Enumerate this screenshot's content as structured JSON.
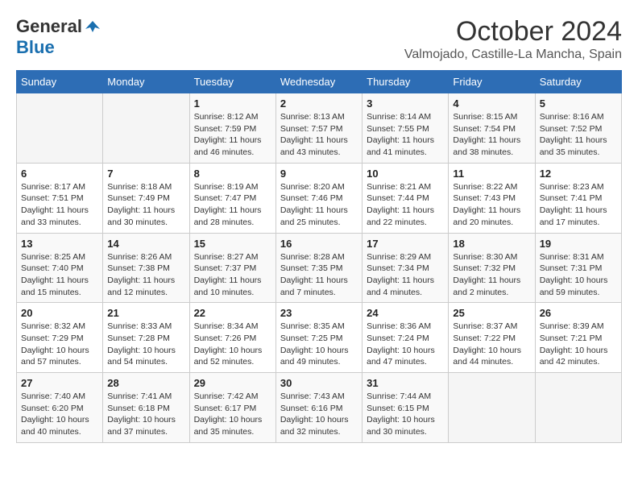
{
  "header": {
    "logo_general": "General",
    "logo_blue": "Blue",
    "month": "October 2024",
    "location": "Valmojado, Castille-La Mancha, Spain"
  },
  "weekdays": [
    "Sunday",
    "Monday",
    "Tuesday",
    "Wednesday",
    "Thursday",
    "Friday",
    "Saturday"
  ],
  "weeks": [
    [
      {
        "day": "",
        "sunrise": "",
        "sunset": "",
        "daylight": ""
      },
      {
        "day": "",
        "sunrise": "",
        "sunset": "",
        "daylight": ""
      },
      {
        "day": "1",
        "sunrise": "Sunrise: 8:12 AM",
        "sunset": "Sunset: 7:59 PM",
        "daylight": "Daylight: 11 hours and 46 minutes."
      },
      {
        "day": "2",
        "sunrise": "Sunrise: 8:13 AM",
        "sunset": "Sunset: 7:57 PM",
        "daylight": "Daylight: 11 hours and 43 minutes."
      },
      {
        "day": "3",
        "sunrise": "Sunrise: 8:14 AM",
        "sunset": "Sunset: 7:55 PM",
        "daylight": "Daylight: 11 hours and 41 minutes."
      },
      {
        "day": "4",
        "sunrise": "Sunrise: 8:15 AM",
        "sunset": "Sunset: 7:54 PM",
        "daylight": "Daylight: 11 hours and 38 minutes."
      },
      {
        "day": "5",
        "sunrise": "Sunrise: 8:16 AM",
        "sunset": "Sunset: 7:52 PM",
        "daylight": "Daylight: 11 hours and 35 minutes."
      }
    ],
    [
      {
        "day": "6",
        "sunrise": "Sunrise: 8:17 AM",
        "sunset": "Sunset: 7:51 PM",
        "daylight": "Daylight: 11 hours and 33 minutes."
      },
      {
        "day": "7",
        "sunrise": "Sunrise: 8:18 AM",
        "sunset": "Sunset: 7:49 PM",
        "daylight": "Daylight: 11 hours and 30 minutes."
      },
      {
        "day": "8",
        "sunrise": "Sunrise: 8:19 AM",
        "sunset": "Sunset: 7:47 PM",
        "daylight": "Daylight: 11 hours and 28 minutes."
      },
      {
        "day": "9",
        "sunrise": "Sunrise: 8:20 AM",
        "sunset": "Sunset: 7:46 PM",
        "daylight": "Daylight: 11 hours and 25 minutes."
      },
      {
        "day": "10",
        "sunrise": "Sunrise: 8:21 AM",
        "sunset": "Sunset: 7:44 PM",
        "daylight": "Daylight: 11 hours and 22 minutes."
      },
      {
        "day": "11",
        "sunrise": "Sunrise: 8:22 AM",
        "sunset": "Sunset: 7:43 PM",
        "daylight": "Daylight: 11 hours and 20 minutes."
      },
      {
        "day": "12",
        "sunrise": "Sunrise: 8:23 AM",
        "sunset": "Sunset: 7:41 PM",
        "daylight": "Daylight: 11 hours and 17 minutes."
      }
    ],
    [
      {
        "day": "13",
        "sunrise": "Sunrise: 8:25 AM",
        "sunset": "Sunset: 7:40 PM",
        "daylight": "Daylight: 11 hours and 15 minutes."
      },
      {
        "day": "14",
        "sunrise": "Sunrise: 8:26 AM",
        "sunset": "Sunset: 7:38 PM",
        "daylight": "Daylight: 11 hours and 12 minutes."
      },
      {
        "day": "15",
        "sunrise": "Sunrise: 8:27 AM",
        "sunset": "Sunset: 7:37 PM",
        "daylight": "Daylight: 11 hours and 10 minutes."
      },
      {
        "day": "16",
        "sunrise": "Sunrise: 8:28 AM",
        "sunset": "Sunset: 7:35 PM",
        "daylight": "Daylight: 11 hours and 7 minutes."
      },
      {
        "day": "17",
        "sunrise": "Sunrise: 8:29 AM",
        "sunset": "Sunset: 7:34 PM",
        "daylight": "Daylight: 11 hours and 4 minutes."
      },
      {
        "day": "18",
        "sunrise": "Sunrise: 8:30 AM",
        "sunset": "Sunset: 7:32 PM",
        "daylight": "Daylight: 11 hours and 2 minutes."
      },
      {
        "day": "19",
        "sunrise": "Sunrise: 8:31 AM",
        "sunset": "Sunset: 7:31 PM",
        "daylight": "Daylight: 10 hours and 59 minutes."
      }
    ],
    [
      {
        "day": "20",
        "sunrise": "Sunrise: 8:32 AM",
        "sunset": "Sunset: 7:29 PM",
        "daylight": "Daylight: 10 hours and 57 minutes."
      },
      {
        "day": "21",
        "sunrise": "Sunrise: 8:33 AM",
        "sunset": "Sunset: 7:28 PM",
        "daylight": "Daylight: 10 hours and 54 minutes."
      },
      {
        "day": "22",
        "sunrise": "Sunrise: 8:34 AM",
        "sunset": "Sunset: 7:26 PM",
        "daylight": "Daylight: 10 hours and 52 minutes."
      },
      {
        "day": "23",
        "sunrise": "Sunrise: 8:35 AM",
        "sunset": "Sunset: 7:25 PM",
        "daylight": "Daylight: 10 hours and 49 minutes."
      },
      {
        "day": "24",
        "sunrise": "Sunrise: 8:36 AM",
        "sunset": "Sunset: 7:24 PM",
        "daylight": "Daylight: 10 hours and 47 minutes."
      },
      {
        "day": "25",
        "sunrise": "Sunrise: 8:37 AM",
        "sunset": "Sunset: 7:22 PM",
        "daylight": "Daylight: 10 hours and 44 minutes."
      },
      {
        "day": "26",
        "sunrise": "Sunrise: 8:39 AM",
        "sunset": "Sunset: 7:21 PM",
        "daylight": "Daylight: 10 hours and 42 minutes."
      }
    ],
    [
      {
        "day": "27",
        "sunrise": "Sunrise: 7:40 AM",
        "sunset": "Sunset: 6:20 PM",
        "daylight": "Daylight: 10 hours and 40 minutes."
      },
      {
        "day": "28",
        "sunrise": "Sunrise: 7:41 AM",
        "sunset": "Sunset: 6:18 PM",
        "daylight": "Daylight: 10 hours and 37 minutes."
      },
      {
        "day": "29",
        "sunrise": "Sunrise: 7:42 AM",
        "sunset": "Sunset: 6:17 PM",
        "daylight": "Daylight: 10 hours and 35 minutes."
      },
      {
        "day": "30",
        "sunrise": "Sunrise: 7:43 AM",
        "sunset": "Sunset: 6:16 PM",
        "daylight": "Daylight: 10 hours and 32 minutes."
      },
      {
        "day": "31",
        "sunrise": "Sunrise: 7:44 AM",
        "sunset": "Sunset: 6:15 PM",
        "daylight": "Daylight: 10 hours and 30 minutes."
      },
      {
        "day": "",
        "sunrise": "",
        "sunset": "",
        "daylight": ""
      },
      {
        "day": "",
        "sunrise": "",
        "sunset": "",
        "daylight": ""
      }
    ]
  ]
}
